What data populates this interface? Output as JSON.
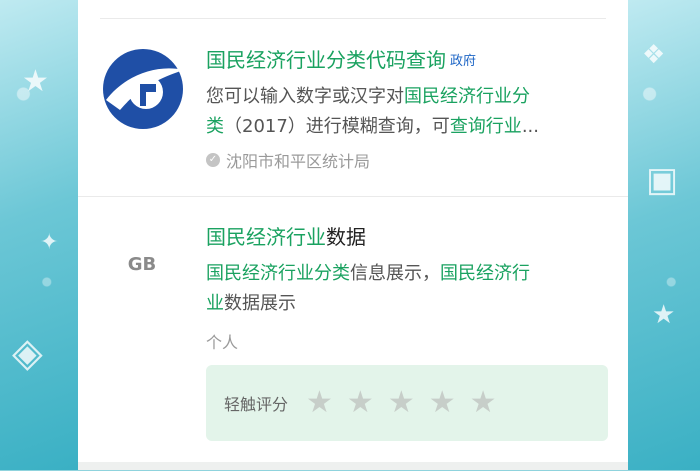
{
  "results": [
    {
      "title": "国民经济行业分类代码查询",
      "tag": "政府",
      "desc_plain1": "您可以输入数字或汉字对",
      "desc_hl1": "国民经济行业分",
      "desc_hl2": "类",
      "desc_plain2": "（2017）进行模糊查询，可",
      "desc_hl3": "查询行业",
      "desc_plain3": "...",
      "source": "沈阳市和平区统计局",
      "logo_icon": "circle-swoosh-logo-icon"
    },
    {
      "title_hl": "国民经济行业",
      "title_plain": "数据",
      "desc_hl1": "国民经济行业分类",
      "desc_plain1": "信息展示，",
      "desc_hl2": "国民经济行",
      "desc_hl3": "业",
      "desc_plain2": "数据展示",
      "source": "个人",
      "logo_icon": "gb-logo-icon",
      "logo_text": "GB",
      "rating_label": "轻触评分",
      "rating_stars": 5
    }
  ],
  "colors": {
    "highlight": "#1aa260",
    "tag": "#1e66c6",
    "rating_bg": "#e3f4ea",
    "logo_blue": "#1f4fa6"
  }
}
